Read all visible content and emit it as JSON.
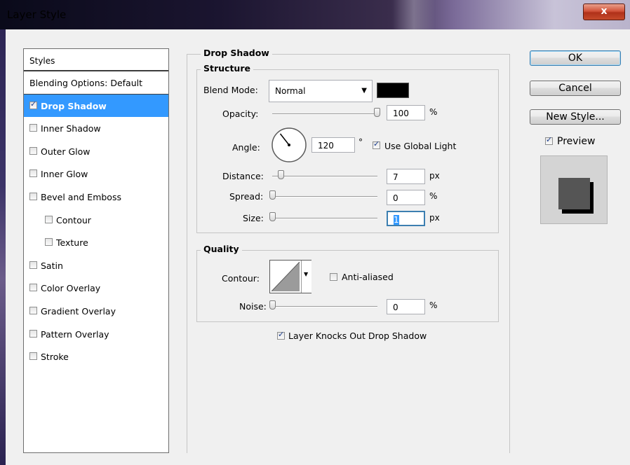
{
  "window": {
    "title": "Layer Style",
    "close_glyph": "x"
  },
  "styles_panel": {
    "header": "Styles",
    "items": [
      {
        "label": "Blending Options: Default",
        "checkbox": false,
        "checked": false,
        "selected": false,
        "indent": 0
      },
      {
        "label": "Drop Shadow",
        "checkbox": true,
        "checked": true,
        "selected": true,
        "indent": 0
      },
      {
        "label": "Inner Shadow",
        "checkbox": true,
        "checked": false,
        "selected": false,
        "indent": 0
      },
      {
        "label": "Outer Glow",
        "checkbox": true,
        "checked": false,
        "selected": false,
        "indent": 0
      },
      {
        "label": "Inner Glow",
        "checkbox": true,
        "checked": false,
        "selected": false,
        "indent": 0
      },
      {
        "label": "Bevel and Emboss",
        "checkbox": true,
        "checked": false,
        "selected": false,
        "indent": 0
      },
      {
        "label": "Contour",
        "checkbox": true,
        "checked": false,
        "selected": false,
        "indent": 1
      },
      {
        "label": "Texture",
        "checkbox": true,
        "checked": false,
        "selected": false,
        "indent": 1
      },
      {
        "label": "Satin",
        "checkbox": true,
        "checked": false,
        "selected": false,
        "indent": 0
      },
      {
        "label": "Color Overlay",
        "checkbox": true,
        "checked": false,
        "selected": false,
        "indent": 0
      },
      {
        "label": "Gradient Overlay",
        "checkbox": true,
        "checked": false,
        "selected": false,
        "indent": 0
      },
      {
        "label": "Pattern Overlay",
        "checkbox": true,
        "checked": false,
        "selected": false,
        "indent": 0
      },
      {
        "label": "Stroke",
        "checkbox": true,
        "checked": false,
        "selected": false,
        "indent": 0
      }
    ]
  },
  "drop_shadow": {
    "title": "Drop Shadow",
    "structure": {
      "title": "Structure",
      "blend_mode_label": "Blend Mode:",
      "blend_mode_value": "Normal",
      "shadow_color": "#000000",
      "opacity_label": "Opacity:",
      "opacity_value": "100",
      "opacity_unit": "%",
      "opacity_level": 1.0,
      "angle_label": "Angle:",
      "angle_value": "120",
      "angle_unit": "°",
      "use_global_light_label": "Use Global Light",
      "use_global_light_checked": true,
      "distance_label": "Distance:",
      "distance_value": "7",
      "distance_unit": "px",
      "distance_level": 0.03,
      "spread_label": "Spread:",
      "spread_value": "0",
      "spread_unit": "%",
      "spread_level": 0.0,
      "size_label": "Size:",
      "size_value": "1",
      "size_unit": "px",
      "size_level": 0.0
    },
    "quality": {
      "title": "Quality",
      "contour_label": "Contour:",
      "anti_aliased_label": "Anti-aliased",
      "anti_aliased_checked": false,
      "noise_label": "Noise:",
      "noise_value": "0",
      "noise_unit": "%",
      "noise_level": 0.0
    },
    "layer_knocks_out_label": "Layer Knocks Out Drop Shadow",
    "layer_knocks_out_checked": true
  },
  "buttons": {
    "ok": "OK",
    "cancel": "Cancel",
    "new_style": "New Style..."
  },
  "preview": {
    "label": "Preview",
    "checked": true
  }
}
